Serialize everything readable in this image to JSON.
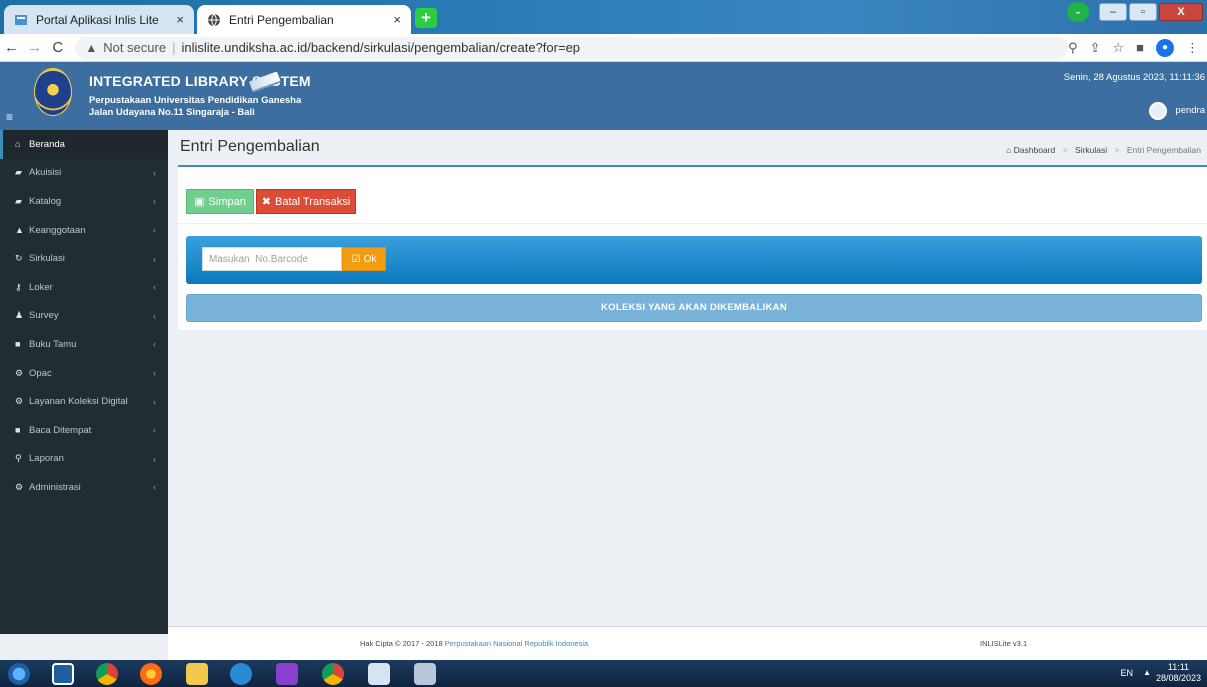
{
  "browser": {
    "tabs": [
      {
        "title": "Portal Aplikasi Inlis Lite",
        "active": false
      },
      {
        "title": "Entri Pengembalian",
        "active": true
      }
    ],
    "close_glyph": "×",
    "new_tab_glyph": "+",
    "address": {
      "security_label": "Not secure",
      "url": "inlislite.undiksha.ac.id/backend/sirkulasi/pengembalian/create?for=ep"
    }
  },
  "header": {
    "system_title": "INTEGRATED LIBRARY SYSTEM",
    "institution_name": "Perpustakaan Universitas Pendidikan Ganesha",
    "institution_address": "Jalan Udayana No.11 Singaraja - Bali",
    "datetime": "Senin, 28 Agustus 2023, 11:11:36",
    "username": "pendra"
  },
  "sidebar": {
    "items": [
      {
        "label": "Beranda",
        "icon": "home-icon",
        "glyph": "⌂",
        "has_children": false
      },
      {
        "label": "Akuisisi",
        "icon": "book-icon",
        "glyph": "▰",
        "has_children": true
      },
      {
        "label": "Katalog",
        "icon": "book-icon",
        "glyph": "▰",
        "has_children": true
      },
      {
        "label": "Keanggotaan",
        "icon": "user-icon",
        "glyph": "▲",
        "has_children": true
      },
      {
        "label": "Sirkulasi",
        "icon": "refresh-icon",
        "glyph": "↻",
        "has_children": true
      },
      {
        "label": "Loker",
        "icon": "key-icon",
        "glyph": "⚷",
        "has_children": true
      },
      {
        "label": "Survey",
        "icon": "group-icon",
        "glyph": "♟",
        "has_children": true
      },
      {
        "label": "Buku Tamu",
        "icon": "guestbook-icon",
        "glyph": "■",
        "has_children": true
      },
      {
        "label": "Opac",
        "icon": "gears-icon",
        "glyph": "⚙",
        "has_children": true
      },
      {
        "label": "Layanan Koleksi Digital",
        "icon": "gears-icon",
        "glyph": "⚙",
        "has_children": true
      },
      {
        "label": "Baca Ditempat",
        "icon": "reader-icon",
        "glyph": "■",
        "has_children": true
      },
      {
        "label": "Laporan",
        "icon": "report-icon",
        "glyph": "⚲",
        "has_children": true
      },
      {
        "label": "Administrasi",
        "icon": "gears-icon",
        "glyph": "⚙",
        "has_children": true
      }
    ],
    "chevron_glyph": "‹"
  },
  "page": {
    "title": "Entri Pengembalian",
    "breadcrumb": {
      "home": "Dashboard",
      "section": "Sirkulasi",
      "current": "Entri Pengembalian"
    },
    "buttons": {
      "save": "Simpan",
      "cancel": "Batal Transaksi",
      "ok": "Ok"
    },
    "barcode_placeholder": "Masukan  No.Barcode",
    "collection_header": "KOLEKSI YANG AKAN DIKEMBALIKAN"
  },
  "footer": {
    "copyright_prefix": "Hak Cipta © 2017 - 2018",
    "copyright_link": "Perpustakaan Nasional Republik Indonesia",
    "version": "INLISLite v3.1"
  },
  "taskbar": {
    "language": "EN",
    "time": "11:11",
    "date": "28/08/2023"
  },
  "colors": {
    "header_bg": "#3c6e9f",
    "sidebar_bg": "#222d32",
    "save_green": "#6fcf8e",
    "cancel_red": "#dd4b39",
    "ok_orange": "#f39c12",
    "panel_blue": "#0b78bd"
  }
}
